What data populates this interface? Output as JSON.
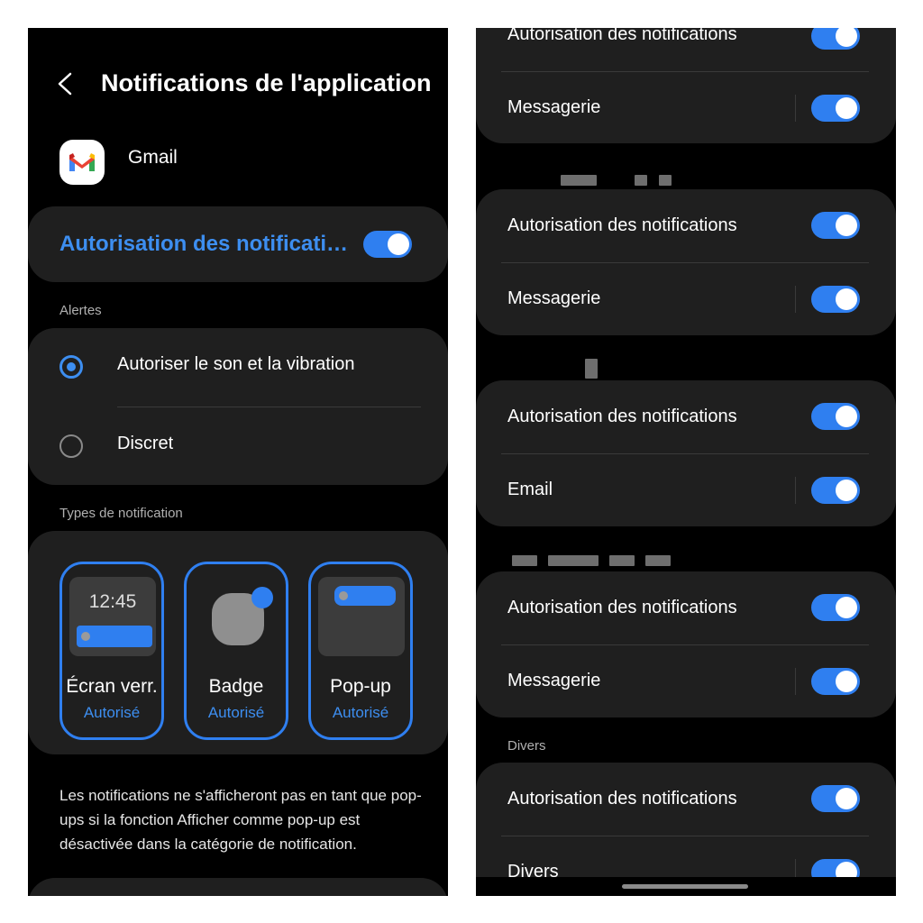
{
  "left": {
    "title": "Notifications de l'application",
    "app_name": "Gmail",
    "master_label": "Autorisation des notificati…",
    "alerts_label": "Alertes",
    "alert_options": [
      {
        "label": "Autoriser le son et la vibration",
        "selected": true
      },
      {
        "label": "Discret",
        "selected": false
      }
    ],
    "types_label": "Types de notification",
    "types": [
      {
        "name": "Écran verr.",
        "status": "Autorisé",
        "preview_time": "12:45"
      },
      {
        "name": "Badge",
        "status": "Autorisé"
      },
      {
        "name": "Pop-up",
        "status": "Autorisé"
      }
    ],
    "note": "Les notifications ne s'afficheront pas en tant que pop-ups si la fonction Afficher comme pop-up est désactivée dans la catégorie de notification."
  },
  "right": {
    "cards": [
      {
        "rows": [
          "Autorisation des notifications",
          "Messagerie"
        ]
      },
      {
        "rows": [
          "Autorisation des notifications",
          "Messagerie"
        ]
      },
      {
        "rows": [
          "Autorisation des notifications",
          "Email"
        ]
      },
      {
        "rows": [
          "Autorisation des notifications",
          "Messagerie"
        ]
      },
      {
        "section": "Divers",
        "rows": [
          "Autorisation des notifications",
          "Divers"
        ]
      }
    ]
  },
  "colors": {
    "background": "#000000",
    "card": "#1f1f1f",
    "accent": "#3d8ef0",
    "toggle_on": "#2f7ff0"
  },
  "icons": [
    "chevron-left-icon",
    "gmail-logo-icon",
    "radio-selected-icon",
    "radio-unselected-icon",
    "toggle-switch-icon"
  ]
}
